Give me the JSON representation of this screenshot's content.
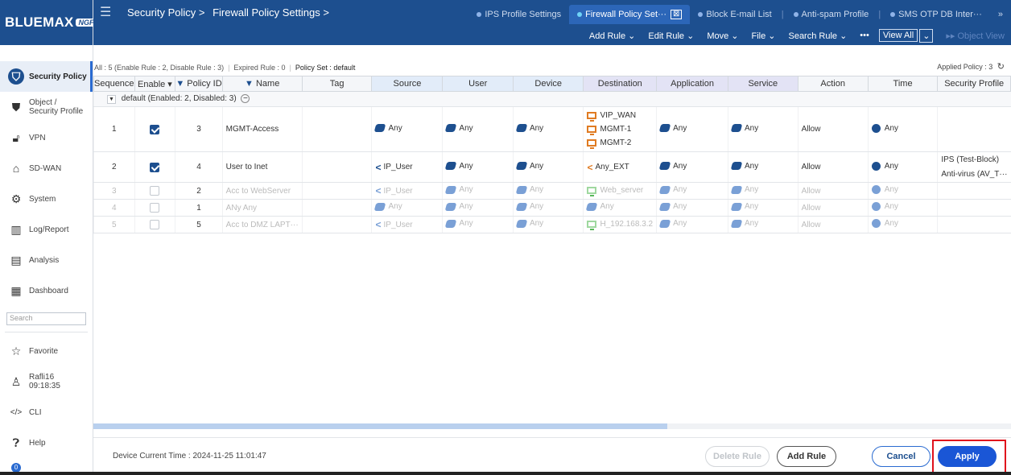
{
  "brand": {
    "name": "BLUEMAX",
    "tag": "NGF"
  },
  "sidebar": {
    "items": [
      {
        "label": "Security Policy",
        "icon": "shield-icon",
        "active": true
      },
      {
        "label": "Object /",
        "label2": "Security Profile",
        "icon": "object-shield-icon"
      },
      {
        "label": "VPN",
        "icon": "lock-icon"
      },
      {
        "label": "SD-WAN",
        "icon": "home-network-icon"
      },
      {
        "label": "System",
        "icon": "gear-icon"
      },
      {
        "label": "Log/Report",
        "icon": "report-chart-icon"
      },
      {
        "label": "Analysis",
        "icon": "analysis-chart-icon"
      },
      {
        "label": "Dashboard",
        "icon": "dashboard-icon"
      }
    ],
    "search_placeholder": "Search",
    "favorite": "Favorite",
    "user_name": "Rafli16",
    "user_time": "09:18:35",
    "cli": "CLI",
    "help": "Help",
    "notification_count": "0"
  },
  "header": {
    "breadcrumb": [
      "Security Policy >",
      "Firewall Policy Settings >"
    ],
    "tabs": [
      {
        "label": "IPS Profile Settings",
        "active": false
      },
      {
        "label": "Firewall Policy Set···",
        "active": true
      },
      {
        "label": "Block E-mail List",
        "active": false
      },
      {
        "label": "Anti-spam Profile",
        "active": false
      },
      {
        "label": "SMS OTP DB Inter···",
        "active": false
      }
    ],
    "tab_close": "⊠",
    "tabs_more": "»",
    "toolbar": {
      "add_rule": "Add Rule ⌄",
      "edit_rule": "Edit Rule ⌄",
      "move": "Move ⌄",
      "file": "File ⌄",
      "search_rule": "Search Rule ⌄",
      "more": "•••",
      "view_all": "View All",
      "view_all_chevron": "⌄",
      "object_view": "▸▸ Object View"
    }
  },
  "summary": {
    "all": "All : 5 (Enable Rule : 2, Disable Rule : 3)",
    "expired": "Expired Rule : 0",
    "policy_set": "Policy Set : default",
    "applied": "Applied Policy : 3",
    "refresh_icon": "refresh-icon"
  },
  "table": {
    "columns": [
      "Sequence",
      "Enable ▾",
      "Policy ID",
      "Name",
      "Tag",
      "Source",
      "User",
      "Device",
      "Destination",
      "Application",
      "Service",
      "Action",
      "Time",
      "Security Profile"
    ],
    "group": "default (Enabled: 2, Disabled: 3)",
    "rows": [
      {
        "seq": "1",
        "enabled": true,
        "id": "3",
        "name": "MGMT-Access",
        "tag": "",
        "source": "Any",
        "user": "Any",
        "device": "Any",
        "destination": [
          "VIP_WAN",
          "MGMT-1",
          "MGMT-2"
        ],
        "application": "Any",
        "service": "Any",
        "action": "Allow",
        "time": "Any",
        "security_profile": []
      },
      {
        "seq": "2",
        "enabled": true,
        "id": "4",
        "name": "User to Inet",
        "tag": "",
        "source": "IP_User",
        "user": "Any",
        "device": "Any",
        "destination": [
          "Any_EXT"
        ],
        "application": "Any",
        "service": "Any",
        "action": "Allow",
        "time": "Any",
        "security_profile": [
          "IPS (Test-Block)",
          "Anti-virus (AV_T···"
        ]
      },
      {
        "seq": "3",
        "enabled": false,
        "id": "2",
        "name": "Acc to WebServer",
        "tag": "",
        "source": "IP_User",
        "user": "Any",
        "device": "Any",
        "destination": [
          "Web_server"
        ],
        "application": "Any",
        "service": "Any",
        "action": "Allow",
        "time": "Any",
        "security_profile": []
      },
      {
        "seq": "4",
        "enabled": false,
        "id": "1",
        "name": "ANy Any",
        "tag": "",
        "source": "Any",
        "user": "Any",
        "device": "Any",
        "destination": [
          "Any"
        ],
        "application": "Any",
        "service": "Any",
        "action": "Allow",
        "time": "Any",
        "security_profile": []
      },
      {
        "seq": "5",
        "enabled": false,
        "id": "5",
        "name": "Acc to DMZ LAPT···",
        "tag": "",
        "source": "IP_User",
        "user": "Any",
        "device": "Any",
        "destination": [
          "H_192.168.3.2"
        ],
        "application": "Any",
        "service": "Any",
        "action": "Allow",
        "time": "Any",
        "security_profile": []
      }
    ]
  },
  "footer": {
    "device_time": "Device Current Time : 2024-11-25 11:01:47",
    "delete_rule": "Delete Rule",
    "add_rule": "Add Rule",
    "cancel": "Cancel",
    "apply": "Apply"
  },
  "colors": {
    "brand": "#1d4f8f",
    "accent": "#1a56d6",
    "highlight": "#e0121c"
  }
}
